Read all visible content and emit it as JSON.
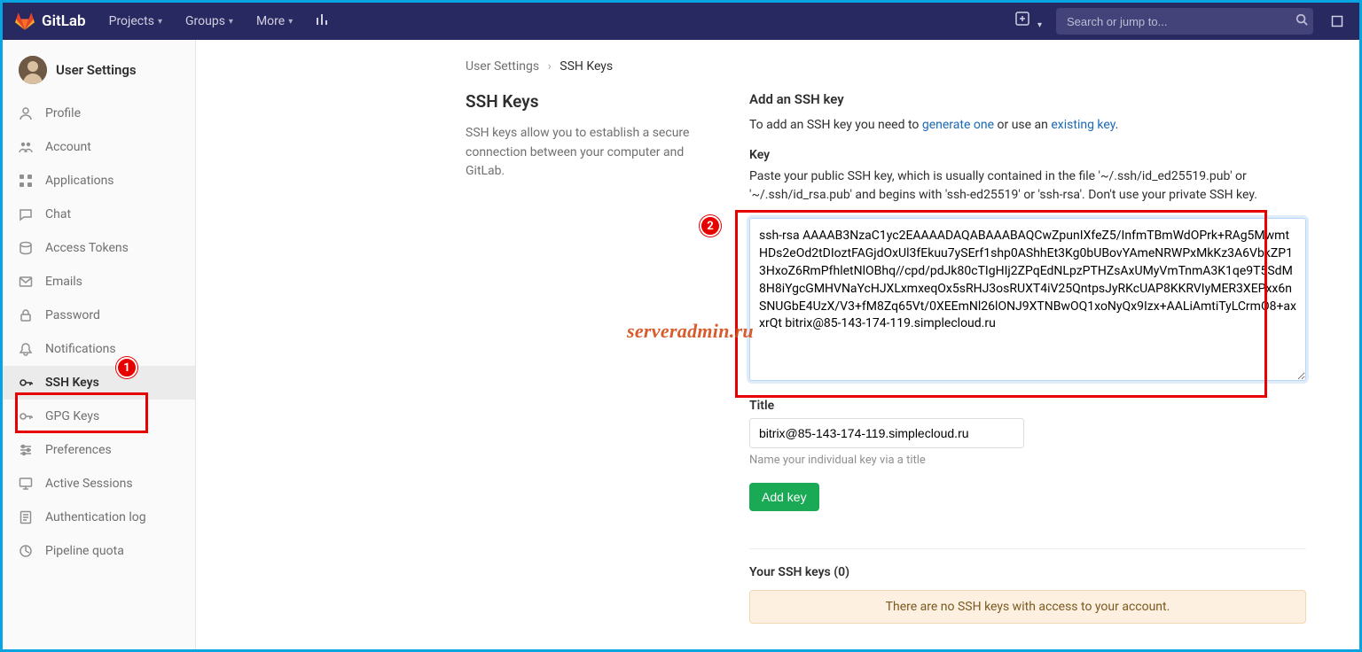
{
  "brand": {
    "name": "GitLab"
  },
  "nav": {
    "items": [
      "Projects",
      "Groups",
      "More"
    ]
  },
  "search": {
    "placeholder": "Search or jump to..."
  },
  "sidebar": {
    "title": "User Settings",
    "items": [
      {
        "label": "Profile",
        "icon": "profile-icon"
      },
      {
        "label": "Account",
        "icon": "account-icon"
      },
      {
        "label": "Applications",
        "icon": "applications-icon"
      },
      {
        "label": "Chat",
        "icon": "chat-icon"
      },
      {
        "label": "Access Tokens",
        "icon": "access-tokens-icon"
      },
      {
        "label": "Emails",
        "icon": "emails-icon"
      },
      {
        "label": "Password",
        "icon": "password-icon"
      },
      {
        "label": "Notifications",
        "icon": "notifications-icon"
      },
      {
        "label": "SSH Keys",
        "icon": "ssh-keys-icon",
        "active": true
      },
      {
        "label": "GPG Keys",
        "icon": "gpg-keys-icon"
      },
      {
        "label": "Preferences",
        "icon": "preferences-icon"
      },
      {
        "label": "Active Sessions",
        "icon": "active-sessions-icon"
      },
      {
        "label": "Authentication log",
        "icon": "auth-log-icon"
      },
      {
        "label": "Pipeline quota",
        "icon": "pipeline-quota-icon"
      }
    ]
  },
  "breadcrumb": {
    "parent": "User Settings",
    "current": "SSH Keys"
  },
  "left": {
    "heading": "SSH Keys",
    "desc": "SSH keys allow you to establish a secure connection between your computer and GitLab."
  },
  "right": {
    "add_heading": "Add an SSH key",
    "add_intro_pre": "To add an SSH key you need to ",
    "link_generate": "generate one",
    "add_intro_mid": " or use an ",
    "link_existing": "existing key",
    "add_intro_post": ".",
    "key_label": "Key",
    "key_hint": "Paste your public SSH key, which is usually contained in the file '~/.ssh/id_ed25519.pub' or '~/.ssh/id_rsa.pub' and begins with 'ssh-ed25519' or 'ssh-rsa'. Don't use your private SSH key.",
    "key_value": "ssh-rsa AAAAB3NzaC1yc2EAAAADAQABAAABAQCwZpunIXfeZ5/InfmTBmWdOPrk+RAg5MwmtHDs2eOd2tDIoztFAGjdOxUl3fEkuu7ySErf1shp0AShhEt3Kg0bUBovYAmeNRWPxMkKz3A6VbkZP13HxoZ6RmPfhletNlOBhq//cpd/pdJk80cTIgHIj2ZPqEdNLpzPTHZsAxUMyVmTnmA3K1qe9T5SdM8H8iYgcGMHVNaYcHJXLxmxeqOx5sRHJ3osRUXT4iV25QntpsJyRKcUAP8KKRVIyMER3XEPxx6nSNUGbE4UzX/V3+fM8Zq65Vt/0XEEmNl26lONJ9XTNBwOQ1xoNyQx9Izx+AALiAmtiTyLCrmO8+axxrQt bitrix@85-143-174-119.simplecloud.ru",
    "title_label": "Title",
    "title_value": "bitrix@85-143-174-119.simplecloud.ru",
    "title_sub": "Name your individual key via a title",
    "add_btn": "Add key",
    "your_keys": "Your SSH keys (0)",
    "empty": "There are no SSH keys with access to your account."
  },
  "annotations": {
    "callout1": "1",
    "callout2": "2"
  },
  "watermark": "serveradmin.ru"
}
